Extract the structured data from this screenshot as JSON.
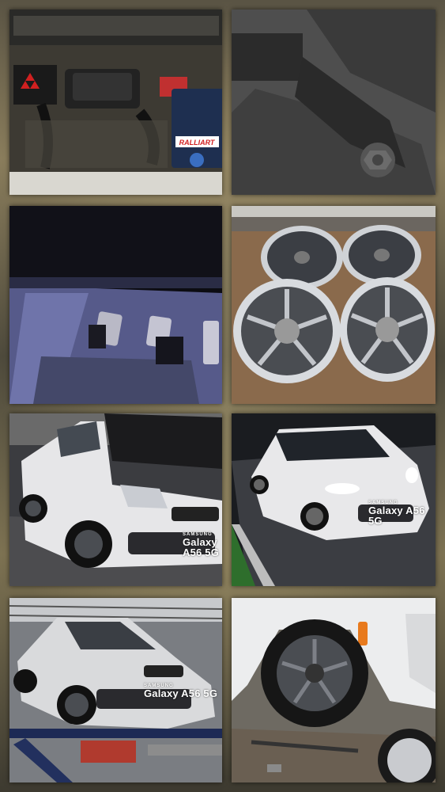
{
  "collage": {
    "photos": [
      {
        "subject": "engine-bay",
        "battery_label": "RALLIART"
      },
      {
        "subject": "strut-mount-bolt"
      },
      {
        "subject": "pedals-with-footwell-lighting"
      },
      {
        "subject": "four-alloy-wheels"
      },
      {
        "subject": "white-hatchback-hood-open-watermarked",
        "watermark": {
          "brand": "SAMSUNG",
          "model": "Galaxy A56 5G"
        }
      },
      {
        "subject": "white-hatchback-night-watermarked",
        "watermark": {
          "brand": "SAMSUNG",
          "model": "Galaxy A56 5G"
        }
      },
      {
        "subject": "car-on-alignment-lift-watermarked",
        "watermark": {
          "brand": "SAMSUNG",
          "model": "Galaxy A56 5G"
        }
      },
      {
        "subject": "wheel-closeup"
      }
    ]
  },
  "colors": {
    "frame": "#6e6450",
    "car_white": "#e9e9ea",
    "wheel_gunmetal": "#4a4d52"
  }
}
